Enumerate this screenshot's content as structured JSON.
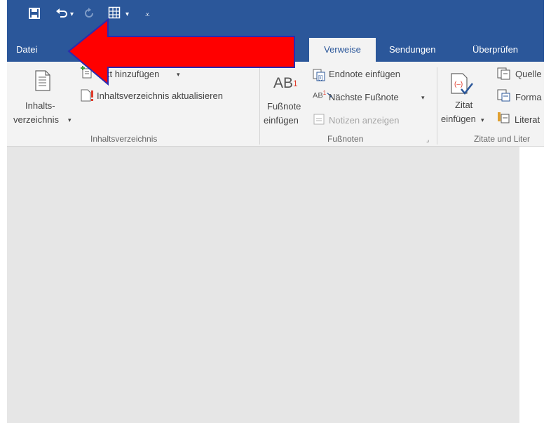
{
  "quick_access": {
    "save_icon": "save-icon",
    "undo_icon": "undo-icon",
    "redo_icon": "redo-icon",
    "table_icon": "table-icon",
    "customize_icon": "customize-qat-icon"
  },
  "tabs": {
    "file": "Datei",
    "references": "Verweise",
    "mailings": "Sendungen",
    "review": "Überprüfen"
  },
  "ribbon": {
    "toc": {
      "button_line1": "Inhalts-",
      "button_line2": "verzeichnis",
      "add_text": "Text hinzufügen",
      "add_text_visible": "xt hinzufügen",
      "update_toc": "Inhaltsverzeichnis aktualisieren",
      "group_label": "Inhaltsverzeichnis"
    },
    "footnotes": {
      "insert_line1": "Fußnote",
      "insert_line2": "einfügen",
      "ab_glyph": "AB",
      "superscript": "1",
      "endnote": "Endnote einfügen",
      "next_footnote": "Nächste Fußnote",
      "show_notes": "Notizen anzeigen",
      "group_label": "Fußnoten"
    },
    "citations": {
      "insert_line1": "Zitat",
      "insert_line2": "einfügen",
      "manage_sources": "Quelle",
      "style": "Forma",
      "bibliography": "Literat",
      "group_label": "Zitate und Liter"
    }
  },
  "colors": {
    "title_bar": "#2b579a",
    "ribbon": "#f3f3f3",
    "workspace": "#e6e6e6",
    "arrow": "#ff0000"
  }
}
